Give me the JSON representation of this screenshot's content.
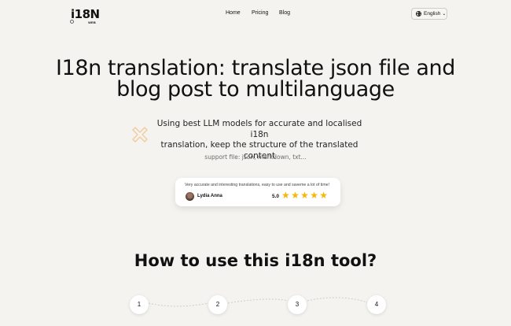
{
  "nav": {
    "logo": {
      "text": "i18N",
      "sub": "WEB"
    },
    "links": [
      "Home",
      "Pricing",
      "Blog"
    ],
    "language": "English"
  },
  "hero": {
    "title_line1": "I18n translation: translate json file and",
    "title_line2": "blog post to multilanguage",
    "desc_line1": "Using best LLM models for accurate and localised i18n",
    "desc_line2": "translation, keep the structure of the translated content",
    "support": "support file: json, markdown, txt..."
  },
  "testimonial": {
    "text": "Very accurate and interesting translations, easy to use and saveme a lot of time!",
    "name": "Lydia Anna",
    "score": "5.0",
    "stars": 5,
    "star_color": "#f5b70a"
  },
  "howto": {
    "title": "How to use this i18n tool?",
    "steps": [
      "1",
      "2",
      "3",
      "4"
    ]
  },
  "colors": {
    "background": "#f4f3ef",
    "accent": "#f3c99a"
  }
}
